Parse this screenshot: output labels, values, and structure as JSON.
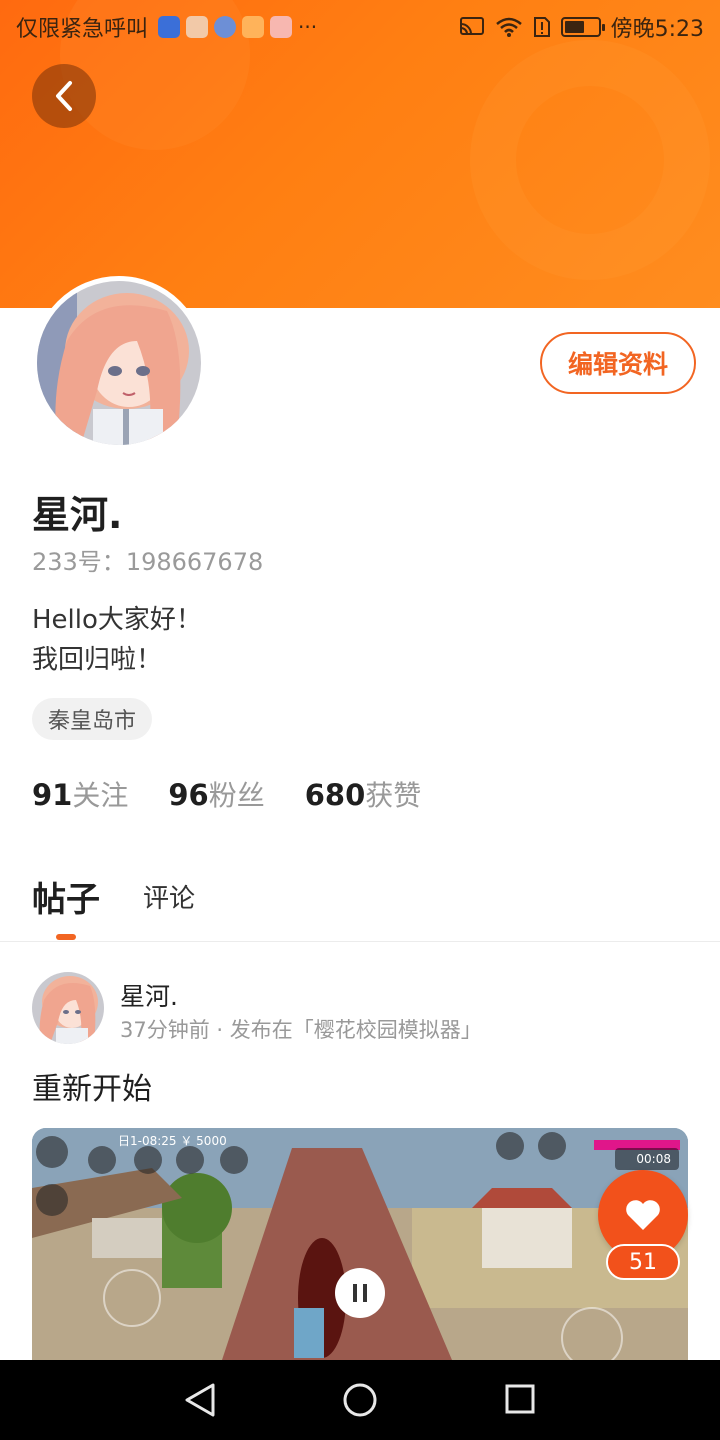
{
  "status_bar": {
    "carrier_text": "仅限紧急呼叫",
    "more": "···",
    "time": "傍晚5:23",
    "battery_level": 0.6
  },
  "header": {
    "back_icon": "chevron-left-icon",
    "edit_label": "编辑资料"
  },
  "profile": {
    "name": "星河.",
    "id_label": "233号：",
    "id_value": "198667678",
    "bio_line1": "Hello大家好！",
    "bio_line2": "我回归啦！",
    "location": "秦皇岛市",
    "stats": [
      {
        "num": "91",
        "label": "关注"
      },
      {
        "num": "96",
        "label": "粉丝"
      },
      {
        "num": "680",
        "label": "获赞"
      }
    ]
  },
  "tabs": {
    "posts": "帖子",
    "comments": "评论"
  },
  "post": {
    "author": "星河.",
    "meta": "37分钟前 · 发布在「樱花校园模拟器」",
    "title": "重新开始",
    "video_hud_time": "日1-08:25 ￥ 5000",
    "video_timer": "00:08",
    "like_count": "51"
  },
  "colors": {
    "accent": "#f26522",
    "header_orange": "#ff7f12",
    "like_red": "#f2511b"
  }
}
